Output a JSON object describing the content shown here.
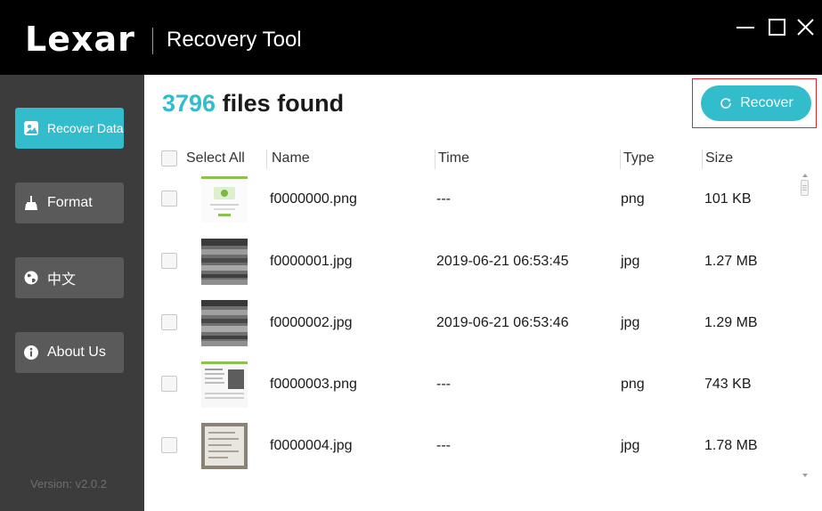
{
  "app": {
    "logo": "Lexar",
    "title": "Recovery Tool"
  },
  "window_controls": {
    "minimize_icon": "minimize-icon",
    "maximize_icon": "maximize-icon",
    "close_icon": "close-icon"
  },
  "sidebar": {
    "items": [
      {
        "label": "Recover Data",
        "icon": "recover-data-icon",
        "active": true
      },
      {
        "label": "Format",
        "icon": "broom-icon",
        "active": false
      },
      {
        "label": "中文",
        "icon": "globe-icon",
        "active": false
      },
      {
        "label": "About Us",
        "icon": "info-icon",
        "active": false
      }
    ],
    "version": "Version: v2.0.2"
  },
  "main": {
    "count": "3796",
    "count_label": " files found",
    "recover_button": "Recover",
    "columns": {
      "select_all": "Select All",
      "name": "Name",
      "time": "Time",
      "type": "Type",
      "size": "Size"
    },
    "rows": [
      {
        "name": "f0000000.png",
        "time": "---",
        "type": "png",
        "size": "101 KB"
      },
      {
        "name": "f0000001.jpg",
        "time": "2019-06-21 06:53:45",
        "type": "jpg",
        "size": "1.27 MB"
      },
      {
        "name": "f0000002.jpg",
        "time": "2019-06-21 06:53:46",
        "type": "jpg",
        "size": "1.29 MB"
      },
      {
        "name": "f0000003.png",
        "time": "---",
        "type": "png",
        "size": "743 KB"
      },
      {
        "name": "f0000004.jpg",
        "time": "---",
        "type": "jpg",
        "size": "1.78 MB"
      }
    ]
  },
  "colors": {
    "accent": "#33bccc",
    "title_bar": "#000000",
    "sidebar": "#3c3c3c",
    "sidebar_button": "#5a5a5a",
    "highlight_frame": "#e0262b"
  }
}
